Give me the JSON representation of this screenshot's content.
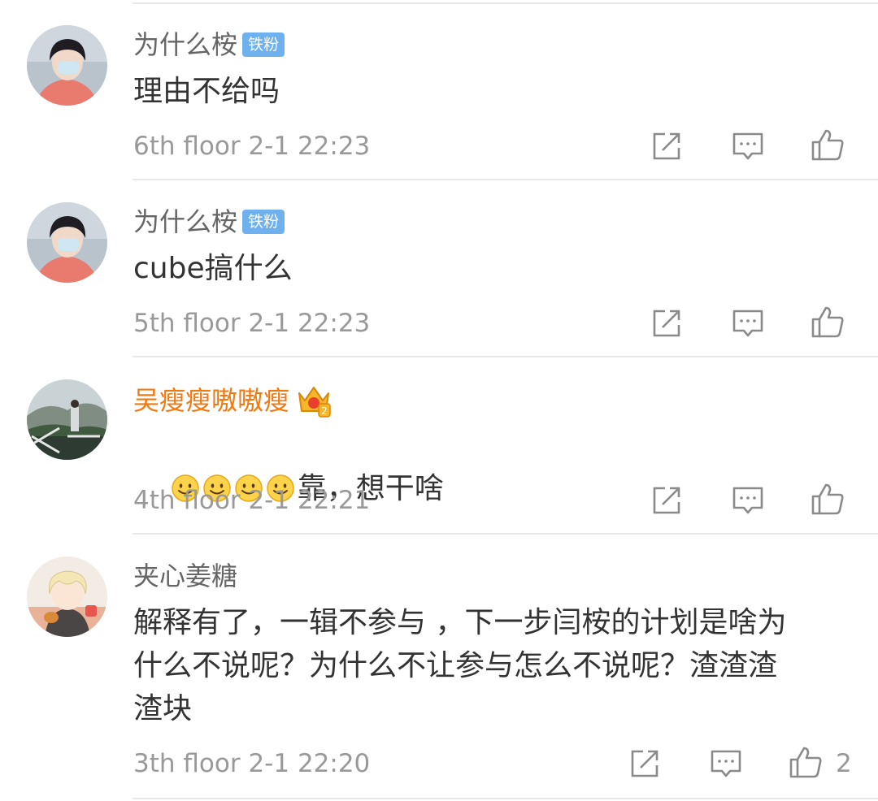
{
  "comments": [
    {
      "username": "为什么桉",
      "badge": "铁粉",
      "text": "理由不给吗",
      "floor": "6th floor",
      "time": "2-1 22:23",
      "like_count": "",
      "avatar_icon": "avatar-masked-boy"
    },
    {
      "username": "为什么桉",
      "badge": "铁粉",
      "text": "cube搞什么",
      "floor": "5th floor",
      "time": "2-1 22:23",
      "like_count": "",
      "avatar_icon": "avatar-masked-boy"
    },
    {
      "username": "吴瘦瘦嗷嗷瘦",
      "badge_icon": "crown-level-2-icon",
      "emoji_count": 4,
      "text": "靠，想干啥",
      "floor": "4th floor",
      "time": "2-1 22:21",
      "like_count": "",
      "avatar_icon": "avatar-landscape-person"
    },
    {
      "username": "夹心姜糖",
      "text": "解释有了，一辑不参与 ，下一步闫桉的计划是啥为\n什么不说呢？为什么不让参与怎么不说呢？渣渣渣\n渣块",
      "floor": "3th floor",
      "time": "2-1 22:20",
      "like_count": "2",
      "avatar_icon": "avatar-cartoon-blond"
    }
  ],
  "colors": {
    "vip_name": "#f07a12",
    "normal_name": "#666666",
    "badge_bg": "#6fb1ef",
    "meta_text": "#999999",
    "icon_stroke": "#8a8a8a"
  },
  "action_icons": [
    "share-icon",
    "comment-icon",
    "like-icon"
  ]
}
